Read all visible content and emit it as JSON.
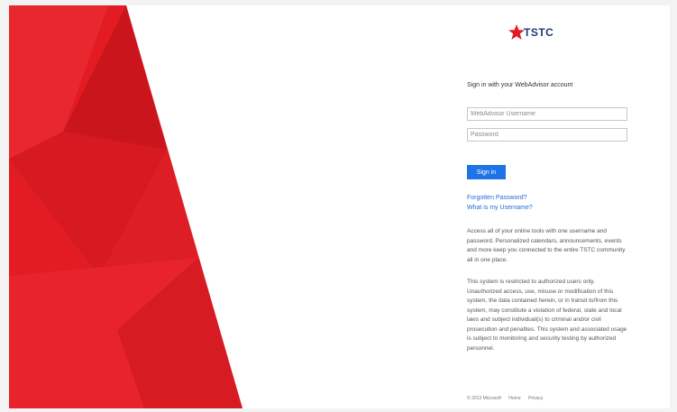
{
  "brand": {
    "logo_text": "TSTC",
    "primary_color": "#e31b23",
    "accent_color": "#1e73e6",
    "logo_color": "#1f3a78"
  },
  "login": {
    "heading": "Sign in with your WebAdvisor account",
    "username_placeholder": "WebAdvisor Username",
    "password_placeholder": "Password",
    "signin_label": "Sign in",
    "forgot_password": "Forgotten Password?",
    "what_username": "What is my Username?"
  },
  "info": {
    "paragraph_1": "Access all of your online tools with one username and password. Personalized calendars, announcements, events and more keep you connected to the entire TSTC community all in one place.",
    "paragraph_2": "This system is restricted to authorized users only. Unauthorized access, use, misuse or modification of this system, the data contained herein, or in transit to/from this system, may constitute a violation of federal, state and local laws and subject individual(s) to criminal and/or civil prosecution and penalties. This system and associated usage is subject to monitoring and security testing by authorized personnel."
  },
  "footer": {
    "copyright": "© 2013 Microsoft",
    "home": "Home",
    "privacy": "Privacy"
  }
}
